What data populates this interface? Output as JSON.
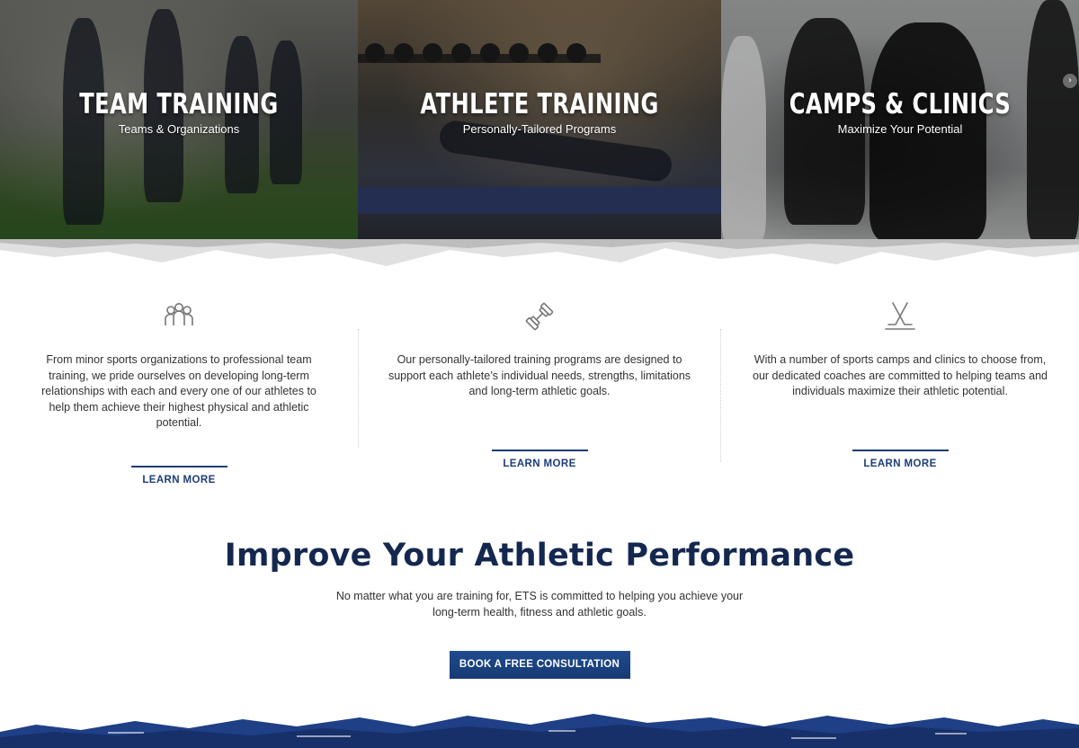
{
  "colors": {
    "brand_navy": "#14284f",
    "link_blue": "#1d3d78",
    "button_blue": "#1f4b8e"
  },
  "hero": {
    "panels": [
      {
        "title": "TEAM TRAINING",
        "subtitle": "Teams & Organizations"
      },
      {
        "title": "ATHLETE TRAINING",
        "subtitle": "Personally-Tailored Programs"
      },
      {
        "title": "CAMPS & CLINICS",
        "subtitle": "Maximize Your Potential"
      }
    ],
    "next_arrow": "›"
  },
  "services": [
    {
      "icon": "team-people-icon",
      "description": "From minor sports organizations to professional team training, we pride ourselves on developing long-term relationships with each and every one of our athletes to help them achieve their highest physical and athletic potential.",
      "link_label": "LEARN MORE"
    },
    {
      "icon": "dumbbell-icon",
      "description": "Our personally-tailored training programs are designed to support each athlete’s individual needs, strengths, limitations and long-term athletic goals.",
      "link_label": "LEARN MORE"
    },
    {
      "icon": "crossed-hockey-sticks-icon",
      "description": "With a number of sports camps and clinics to choose from, our dedicated coaches are committed to helping teams and individuals maximize their athletic potential.",
      "link_label": "LEARN MORE"
    }
  ],
  "cta": {
    "title": "Improve Your Athletic Performance",
    "text": "No matter what you are training for, ETS is committed to helping you achieve your long-term health, fitness and athletic goals.",
    "button_label": "BOOK A FREE CONSULTATION"
  }
}
